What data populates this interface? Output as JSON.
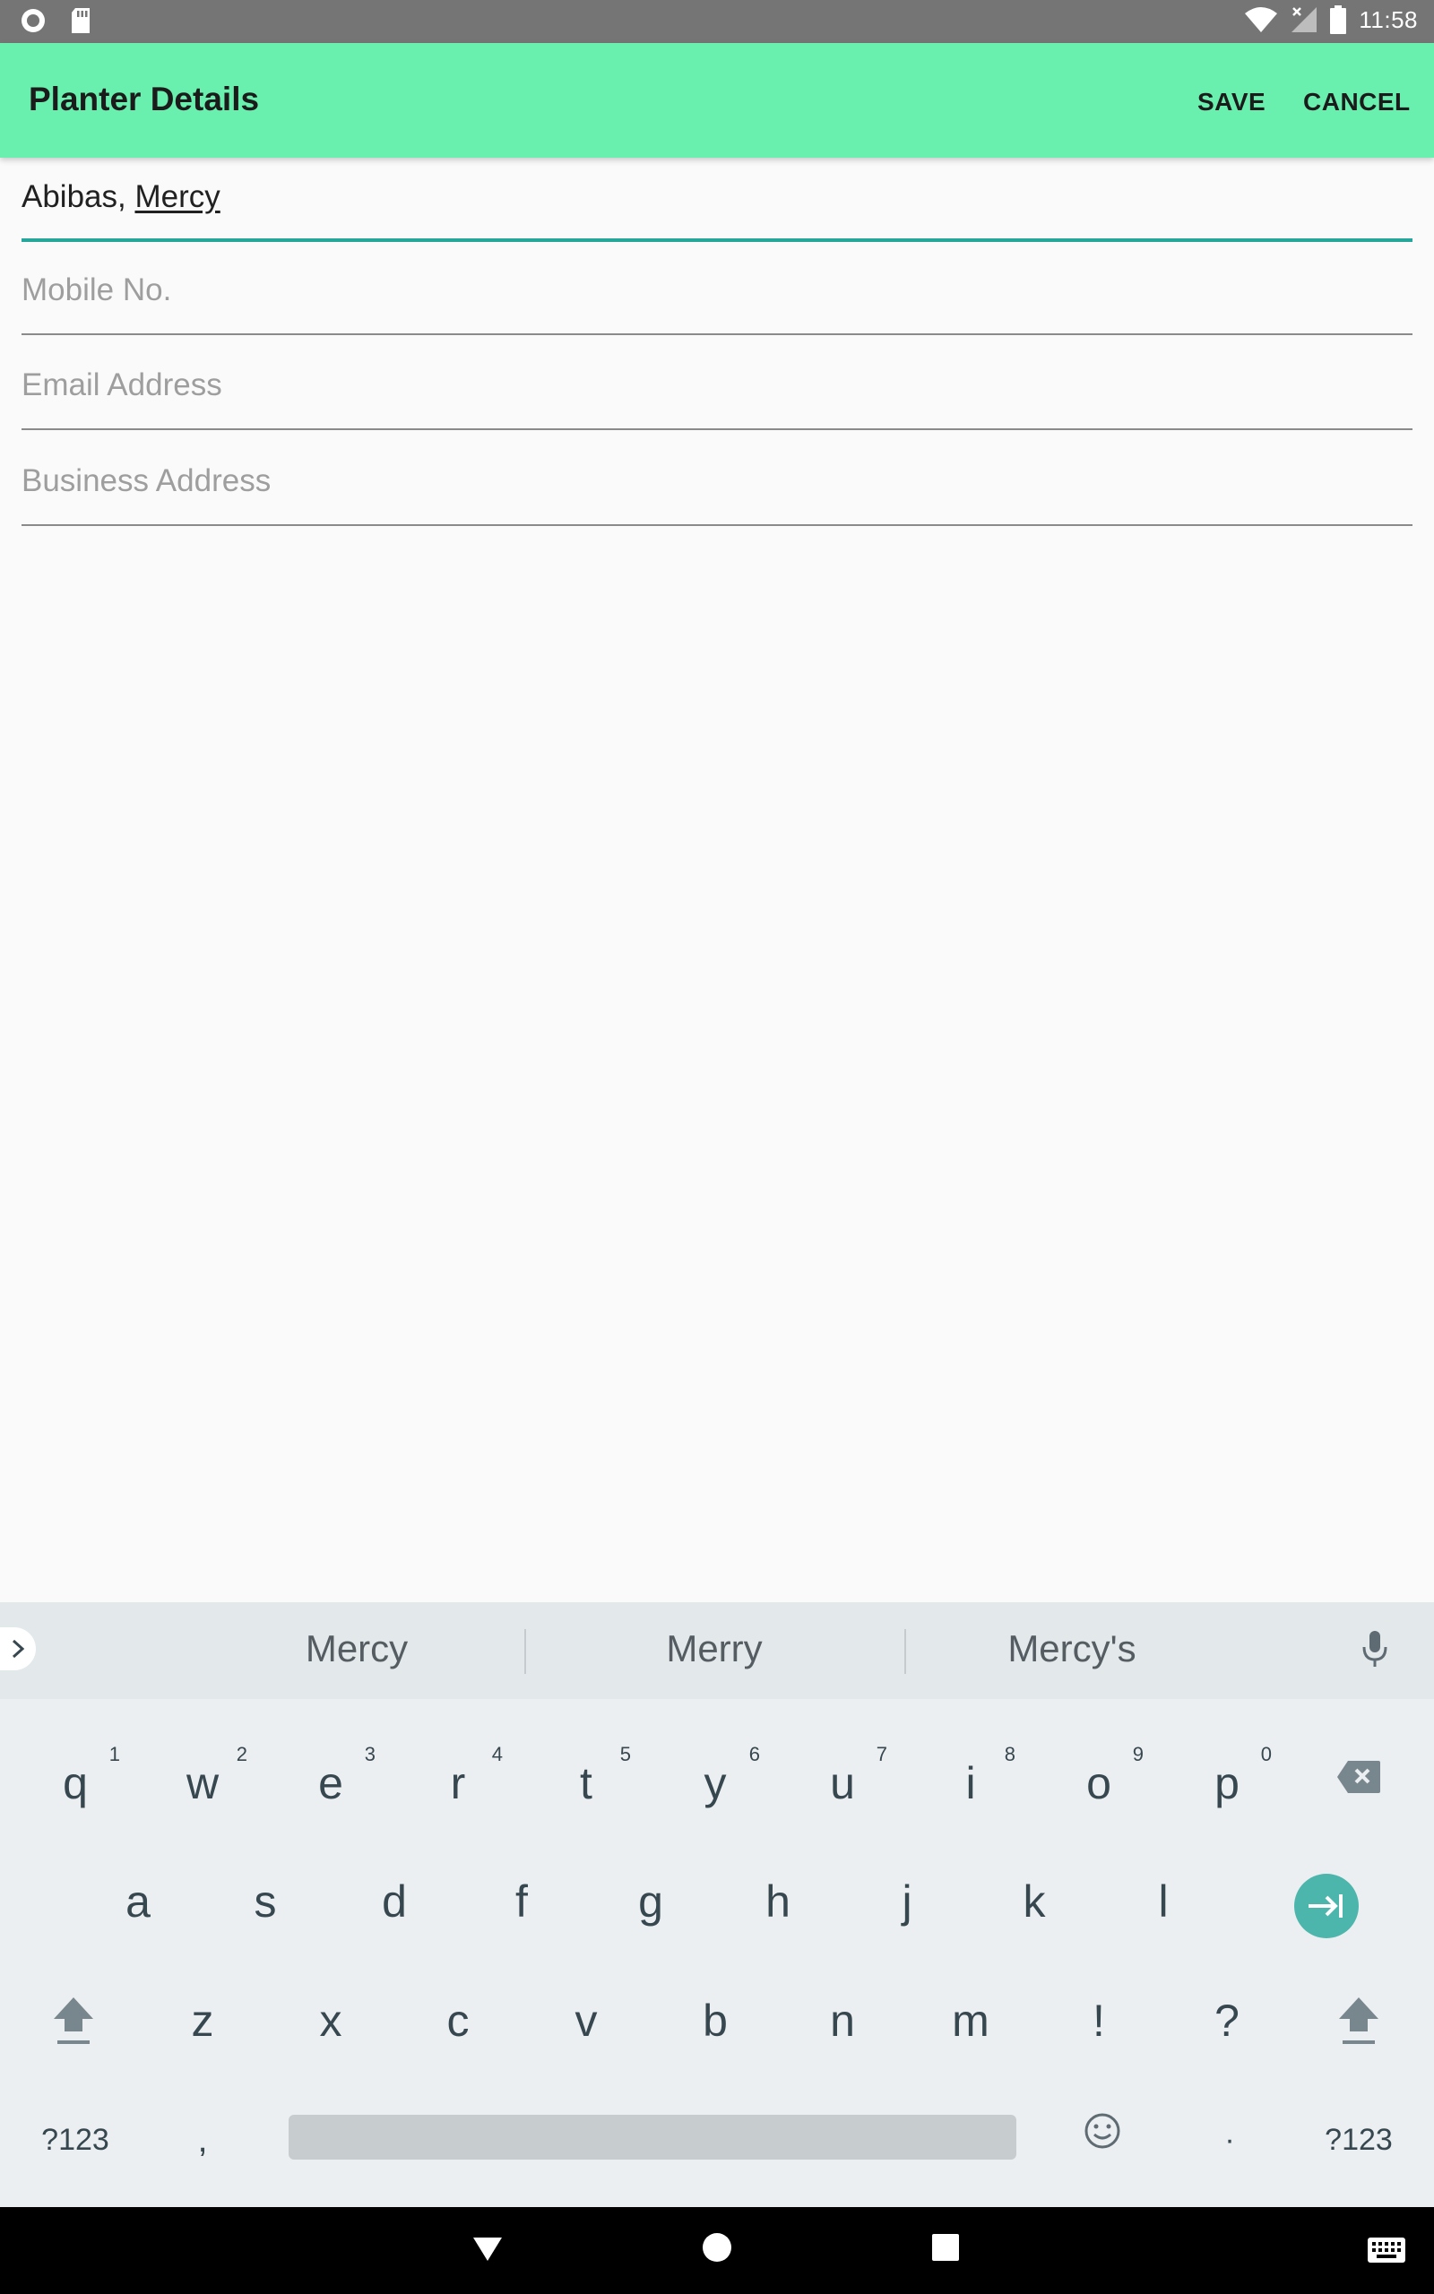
{
  "status_bar": {
    "time": "11:58",
    "icons": [
      "record-icon",
      "sd-card-icon",
      "wifi-icon",
      "no-signal-icon",
      "battery-icon"
    ]
  },
  "app_bar": {
    "title": "Planter Details",
    "save_label": "SAVE",
    "cancel_label": "CANCEL",
    "background_color": "#69f0ae"
  },
  "form": {
    "name_field": {
      "value_prefix": "Abibas, ",
      "value_composing": "Mercy"
    },
    "mobile_field": {
      "placeholder": "Mobile No."
    },
    "email_field": {
      "placeholder": "Email Address"
    },
    "address_field": {
      "placeholder": "Business Address"
    },
    "accent_color": "#26a69a"
  },
  "keyboard": {
    "suggestions": [
      "Mercy",
      "Merry",
      "Mercy's"
    ],
    "row1": [
      {
        "label": "q",
        "hint": "1"
      },
      {
        "label": "w",
        "hint": "2"
      },
      {
        "label": "e",
        "hint": "3"
      },
      {
        "label": "r",
        "hint": "4"
      },
      {
        "label": "t",
        "hint": "5"
      },
      {
        "label": "y",
        "hint": "6"
      },
      {
        "label": "u",
        "hint": "7"
      },
      {
        "label": "i",
        "hint": "8"
      },
      {
        "label": "o",
        "hint": "9"
      },
      {
        "label": "p",
        "hint": "0"
      }
    ],
    "row2": [
      "a",
      "s",
      "d",
      "f",
      "g",
      "h",
      "j",
      "k",
      "l"
    ],
    "row3": [
      "z",
      "x",
      "c",
      "v",
      "b",
      "n",
      "m",
      "!",
      "?"
    ],
    "row4": {
      "symbols_left": "?123",
      "comma": ",",
      "period": "·",
      "symbols_right": "?123"
    }
  },
  "nav_bar": {
    "icons": [
      "back-icon",
      "home-icon",
      "recents-icon",
      "keyboard-switch-icon"
    ]
  }
}
